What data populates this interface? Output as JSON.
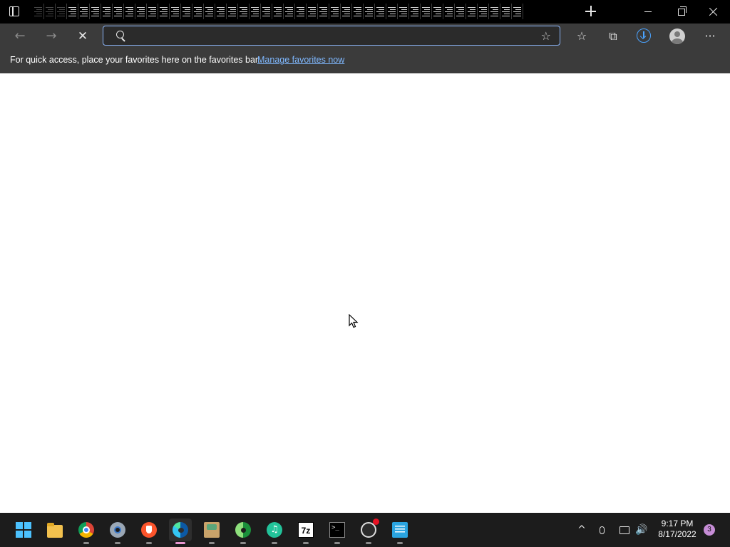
{
  "browser": {
    "tabs_count": 43,
    "omnibox": {
      "value": "",
      "placeholder": ""
    },
    "stop_label": "✕",
    "back_label": "←",
    "forward_label": "→",
    "more_label": "···",
    "favorites_bar": {
      "message": "For quick access, place your favorites here on the favorites bar.",
      "link": "Manage favorites now"
    },
    "accent": "#8ab4f8",
    "link_color": "#7fb8ff"
  },
  "taskbar": {
    "apps": [
      {
        "name": "start",
        "icon": "windows-icon"
      },
      {
        "name": "file-explorer",
        "icon": "folder-icon"
      },
      {
        "name": "chrome",
        "icon": "chrome-icon"
      },
      {
        "name": "settings",
        "icon": "gear-icon"
      },
      {
        "name": "brave",
        "icon": "brave-icon"
      },
      {
        "name": "edge",
        "icon": "edge-icon",
        "active": true
      },
      {
        "name": "archive-manager",
        "icon": "archive-icon"
      },
      {
        "name": "edge-dev",
        "icon": "edge-dev-icon"
      },
      {
        "name": "music",
        "icon": "music-icon"
      },
      {
        "name": "7zip",
        "icon": "7zip-icon",
        "label": "7z"
      },
      {
        "name": "terminal",
        "icon": "terminal-icon",
        "label": ">_"
      },
      {
        "name": "obs",
        "icon": "obs-icon"
      },
      {
        "name": "notepad",
        "icon": "notepad-icon"
      }
    ],
    "clock": {
      "time": "9:17 PM",
      "date": "8/17/2022"
    },
    "notification_count": "3",
    "chevron": "^",
    "volume": "🔊"
  }
}
